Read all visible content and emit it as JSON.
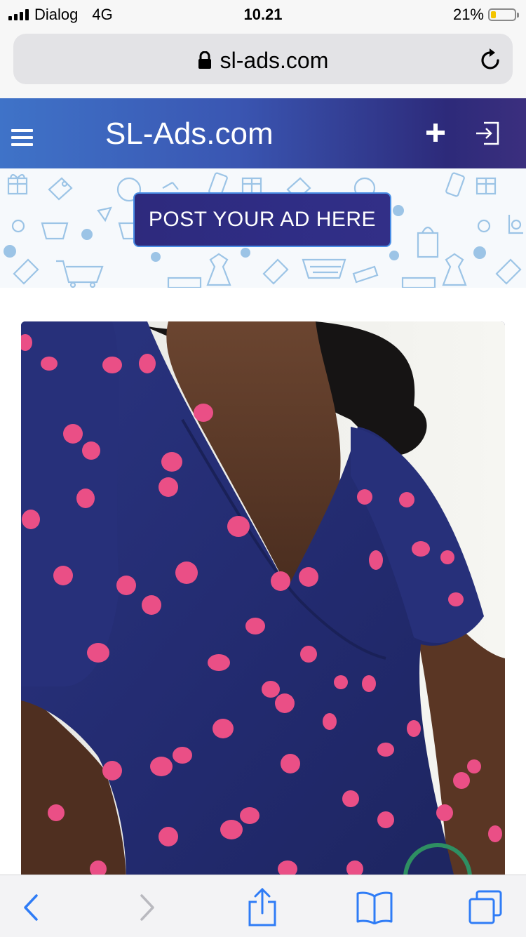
{
  "status_bar": {
    "carrier": "Dialog",
    "network": "4G",
    "time": "10.21",
    "battery": "21%",
    "battery_level": 0.21
  },
  "browser": {
    "url": "sl-ads.com"
  },
  "site": {
    "title": "SL-Ads.com",
    "post_ad_label": "POST YOUR AD HERE"
  },
  "colors": {
    "header_start": "#3f73c8",
    "header_end": "#2d2a7a",
    "button_bg": "#2e2a7d",
    "button_border": "#4a8ee6",
    "ios_blue": "#2f7cf6"
  },
  "toolbar": {
    "icons": [
      "back-icon",
      "forward-icon",
      "share-icon",
      "bookmarks-icon",
      "tabs-icon"
    ]
  }
}
